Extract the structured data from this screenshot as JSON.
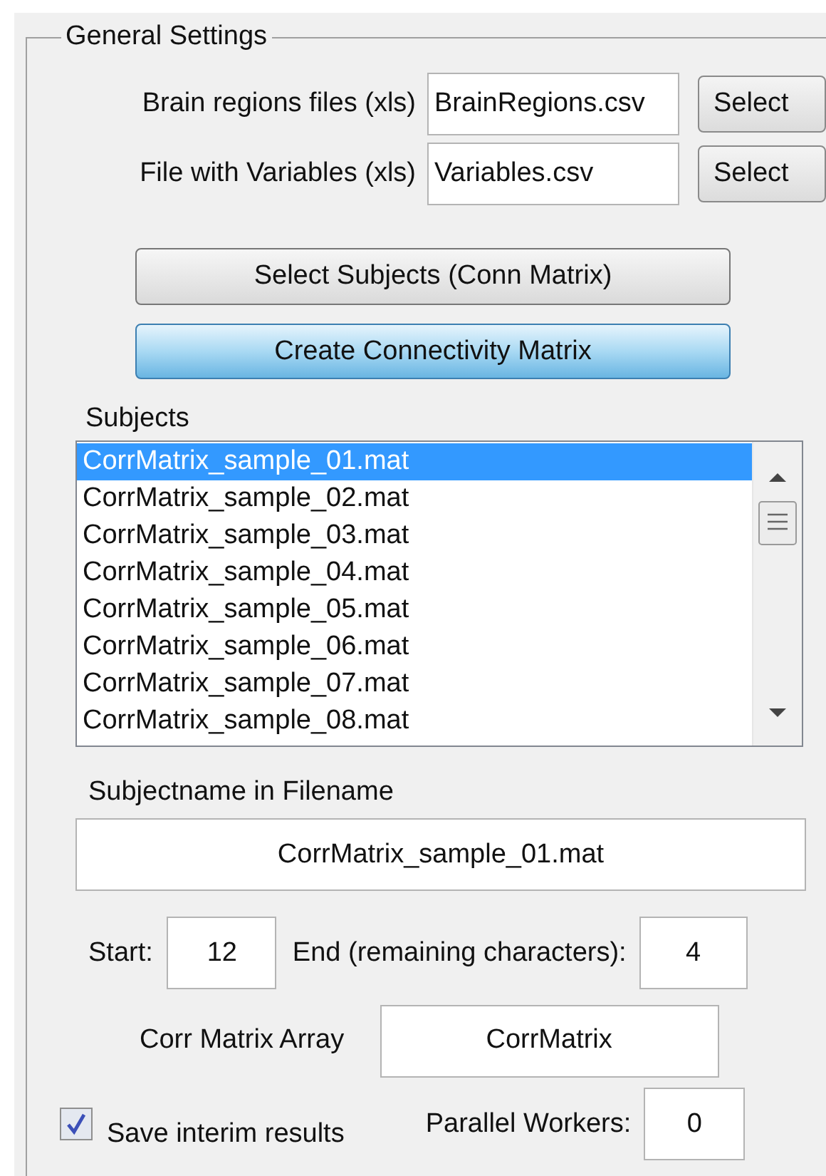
{
  "group": {
    "title": "General Settings"
  },
  "file_rows": [
    {
      "label": "Brain regions files (xls)",
      "value": "BrainRegions.csv",
      "button": "Select"
    },
    {
      "label": "File with Variables (xls)",
      "value": "Variables.csv",
      "button": "Select"
    }
  ],
  "buttons": [
    {
      "label": "Select Subjects (Conn Matrix)",
      "kind": "plain"
    },
    {
      "label": "Create Connectivity Matrix",
      "kind": "default"
    }
  ],
  "subjects": {
    "label": "Subjects",
    "items": [
      {
        "text": "CorrMatrix_sample_01.mat",
        "selected": true
      },
      {
        "text": "CorrMatrix_sample_02.mat",
        "selected": false
      },
      {
        "text": "CorrMatrix_sample_03.mat",
        "selected": false
      },
      {
        "text": "CorrMatrix_sample_04.mat",
        "selected": false
      },
      {
        "text": "CorrMatrix_sample_05.mat",
        "selected": false
      },
      {
        "text": "CorrMatrix_sample_06.mat",
        "selected": false
      },
      {
        "text": "CorrMatrix_sample_07.mat",
        "selected": false
      },
      {
        "text": "CorrMatrix_sample_08.mat",
        "selected": false
      }
    ]
  },
  "subjectname": {
    "label": "Subjectname in Filename",
    "value": "CorrMatrix_sample_01.mat"
  },
  "start": {
    "label": "Start:",
    "value": "12"
  },
  "end": {
    "label": "End (remaining characters):",
    "value": "4"
  },
  "array": {
    "label": "Corr Matrix Array",
    "value": "CorrMatrix"
  },
  "save_interim": {
    "label": "Save interim results",
    "checked": true
  },
  "workers": {
    "label": "Parallel Workers:",
    "value": "0"
  }
}
